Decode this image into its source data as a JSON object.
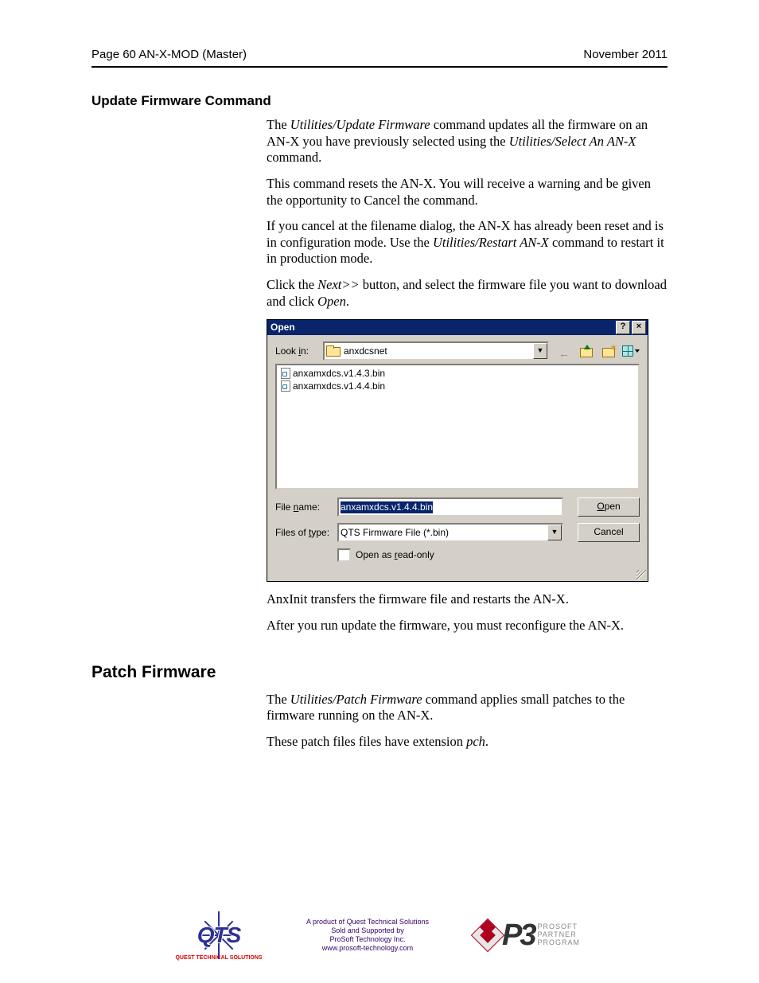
{
  "header": {
    "left": "Page  60  AN-X-MOD (Master)",
    "right": "November 2011"
  },
  "section1": {
    "title": "Update Firmware Command",
    "p1a": "The ",
    "p1b": "Utilities/Update Firmware",
    "p1c": " command updates all the firmware on an AN-X you have previously selected using the ",
    "p1d": "Utilities/Select An AN-X",
    "p1e": " command.",
    "p2": "This command resets the AN-X.  You will receive a warning and be given the opportunity to Cancel the command.",
    "p3a": "If you cancel at the filename dialog, the AN-X has already been reset and is in configuration mode.  Use the ",
    "p3b": "Utilities/Restart AN-X",
    "p3c": " command to restart it in production mode.",
    "p4a": "Click the ",
    "p4b": "Next>>",
    "p4c": " button, and select the firmware file you want to download and click ",
    "p4d": "Open",
    "p4e": ".",
    "p5": "AnxInit transfers the firmware file and restarts the AN-X.",
    "p6": "After you run update the firmware, you must reconfigure the AN-X."
  },
  "dialog": {
    "title": "Open",
    "help": "?",
    "close": "×",
    "lookin_pre": "Look ",
    "lookin_u": "i",
    "lookin_post": "n:",
    "lookin_value": "anxdcsnet",
    "dropdown_glyph": "▼",
    "back_glyph": "←",
    "views_dd": "▼",
    "files": [
      "anxamxdcs.v1.4.3.bin",
      "anxamxdcs.v1.4.4.bin"
    ],
    "filename_pre": "File ",
    "filename_u": "n",
    "filename_post": "ame:",
    "filename_value": "anxamxdcs.v1.4.4.bin",
    "type_pre": "Files of ",
    "type_u": "t",
    "type_post": "ype:",
    "type_value": "QTS Firmware File (*.bin)",
    "open_u": "O",
    "open_post": "pen",
    "cancel": "Cancel",
    "readonly_pre": "Open as ",
    "readonly_u": "r",
    "readonly_post": "ead-only"
  },
  "section2": {
    "title": "Patch Firmware",
    "p1a": "The ",
    "p1b": "Utilities/Patch Firmware",
    "p1c": " command applies small patches to the firmware running on the AN-X.",
    "p2a": "These patch files files have extension ",
    "p2b": "pch",
    "p2c": "."
  },
  "footer": {
    "qts": "QTS",
    "qts_sub": "QUEST TECHNICAL SOLUTIONS",
    "mid1": "A product of Quest Technical Solutions",
    "mid2": "Sold and Supported by",
    "mid3": "ProSoft Technology Inc.",
    "mid4": "www.prosoft-technology.com",
    "p3": "P3",
    "p3s1": "PROSOFT",
    "p3s2": "PARTNER",
    "p3s3": "PROGRAM"
  }
}
